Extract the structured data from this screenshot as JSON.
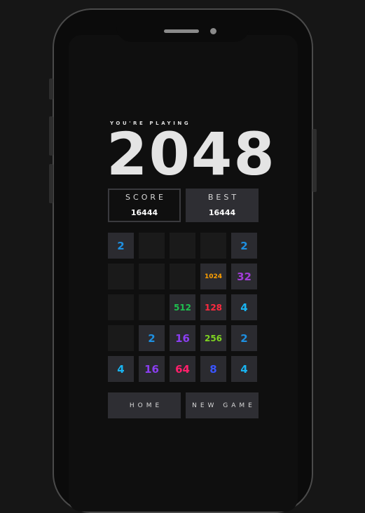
{
  "header": {
    "kicker": "YOU'RE PLAYING",
    "title": "2048"
  },
  "scores": {
    "score_label": "SCORE",
    "score_value": "16444",
    "best_label": "BEST",
    "best_value": "16444"
  },
  "board": {
    "rows": [
      [
        "2",
        "",
        "",
        "",
        "2"
      ],
      [
        "",
        "",
        "",
        "1024",
        "32"
      ],
      [
        "",
        "",
        "512",
        "128",
        "4"
      ],
      [
        "",
        "2",
        "16",
        "256",
        "2"
      ],
      [
        "4",
        "16",
        "64",
        "8",
        "4"
      ]
    ],
    "colors": {
      "2": "#1e8fe0",
      "4": "#19b3f0",
      "8": "#3a55ff",
      "16": "#8a3ef0",
      "32": "#a23cd8",
      "64": "#ff1f6b",
      "128": "#ff2a3f",
      "256": "#7ed321",
      "512": "#1fbf4f",
      "1024": "#ffa000"
    }
  },
  "buttons": {
    "home_label": "HOME",
    "new_game_label": "NEW GAME"
  }
}
